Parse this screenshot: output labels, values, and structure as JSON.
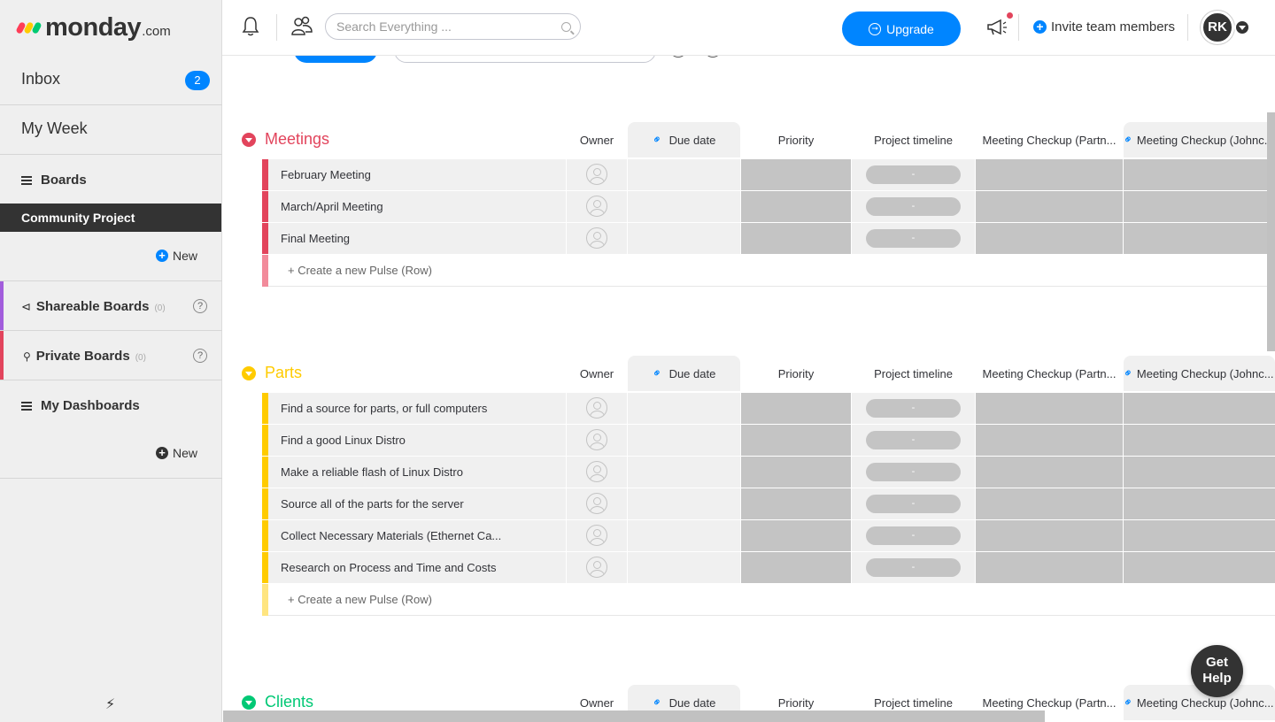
{
  "brand": {
    "word": "monday",
    "suffix": ".com",
    "dot_colors": [
      "#ff3d57",
      "#ffcb00",
      "#00ca72"
    ]
  },
  "sidebar": {
    "inbox": {
      "label": "Inbox",
      "badge": "2"
    },
    "my_week": {
      "label": "My Week"
    },
    "boards": {
      "label": "Boards",
      "active_board": "Community Project",
      "new_label": "New"
    },
    "shareable": {
      "label": "Shareable Boards",
      "count": "(0)",
      "help": "?",
      "color": "#a25ddc"
    },
    "private": {
      "label": "Private Boards",
      "count": "(0)",
      "help": "?",
      "color": "#e2445c"
    },
    "dashboards": {
      "label": "My Dashboards",
      "new_label": "New"
    }
  },
  "topbar": {
    "search_placeholder": "Search Everything ...",
    "upgrade_label": "Upgrade",
    "invite_label": "Invite team members",
    "avatar_initials": "RK"
  },
  "columns": {
    "owner": "Owner",
    "due_date": "Due date",
    "priority": "Priority",
    "timeline": "Project timeline",
    "checkup1": "Meeting Checkup (Partn...",
    "checkup2": "Meeting Checkup (Johnc..."
  },
  "groups": [
    {
      "title": "Meetings",
      "color": "#e2445c",
      "light_color": "#f28b9b",
      "rows": [
        "February Meeting",
        "March/April Meeting",
        "Final Meeting"
      ],
      "create_label": "+ Create a new Pulse (Row)"
    },
    {
      "title": "Parts",
      "color": "#ffcb00",
      "light_color": "#ffe580",
      "rows": [
        "Find a source for parts, or full computers",
        "Find a good Linux Distro",
        "Make a reliable flash of Linux Distro",
        "Source all of the parts for the server",
        "Collect Necessary Materials (Ethernet Ca...",
        "Research on Process and Time and Costs"
      ],
      "create_label": "+ Create a new Pulse (Row)"
    },
    {
      "title": "Clients",
      "color": "#00c875",
      "light_color": "#80e3ba",
      "rows": [],
      "create_label": ""
    }
  ],
  "timeline_placeholder": "-",
  "get_help": {
    "line1": "Get",
    "line2": "Help"
  }
}
